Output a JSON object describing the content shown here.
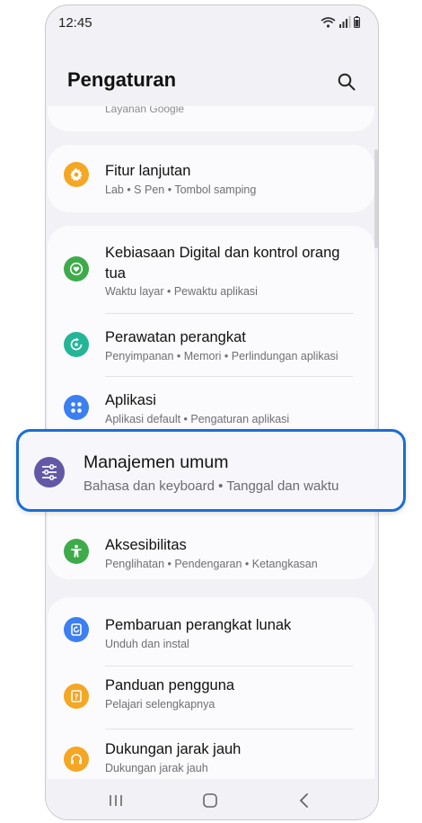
{
  "status": {
    "time": "12:45"
  },
  "header": {
    "title": "Pengaturan"
  },
  "partial_item": {
    "subtitle": "Layanan Google"
  },
  "items": [
    {
      "title": "Fitur lanjutan",
      "subtitle": "Lab  •  S Pen  •  Tombol samping",
      "icon": "puzzle-icon",
      "color": "#f5a623"
    },
    {
      "title": "Kebiasaan Digital dan kontrol orang tua",
      "subtitle": "Waktu layar  •  Pewaktu aplikasi",
      "icon": "heart-icon",
      "color": "#3eab4a"
    },
    {
      "title": "Perawatan perangkat",
      "subtitle": "Penyimpanan  •  Memori  •  Perlindungan aplikasi",
      "icon": "refresh-icon",
      "color": "#24b597"
    },
    {
      "title": "Aplikasi",
      "subtitle": "Aplikasi default  •  Pengaturan aplikasi",
      "icon": "apps-icon",
      "color": "#3c7ff0"
    },
    {
      "title": "Manajemen umum",
      "subtitle": "Bahasa dan keyboard  •  Tanggal dan waktu",
      "icon": "sliders-icon",
      "color": "#6358a6"
    },
    {
      "title": "Aksesibilitas",
      "subtitle": "Penglihatan  •  Pendengaran  •  Ketangkasan",
      "icon": "accessibility-icon",
      "color": "#3eab4a"
    },
    {
      "title": "Pembaruan perangkat lunak",
      "subtitle": "Unduh dan instal",
      "icon": "update-icon",
      "color": "#3c7ff0"
    },
    {
      "title": "Panduan pengguna",
      "subtitle": "Pelajari selengkapnya",
      "icon": "guide-icon",
      "color": "#f5a623"
    },
    {
      "title": "Dukungan jarak jauh",
      "subtitle": "Dukungan jarak jauh",
      "icon": "headset-icon",
      "color": "#f5a623"
    }
  ]
}
